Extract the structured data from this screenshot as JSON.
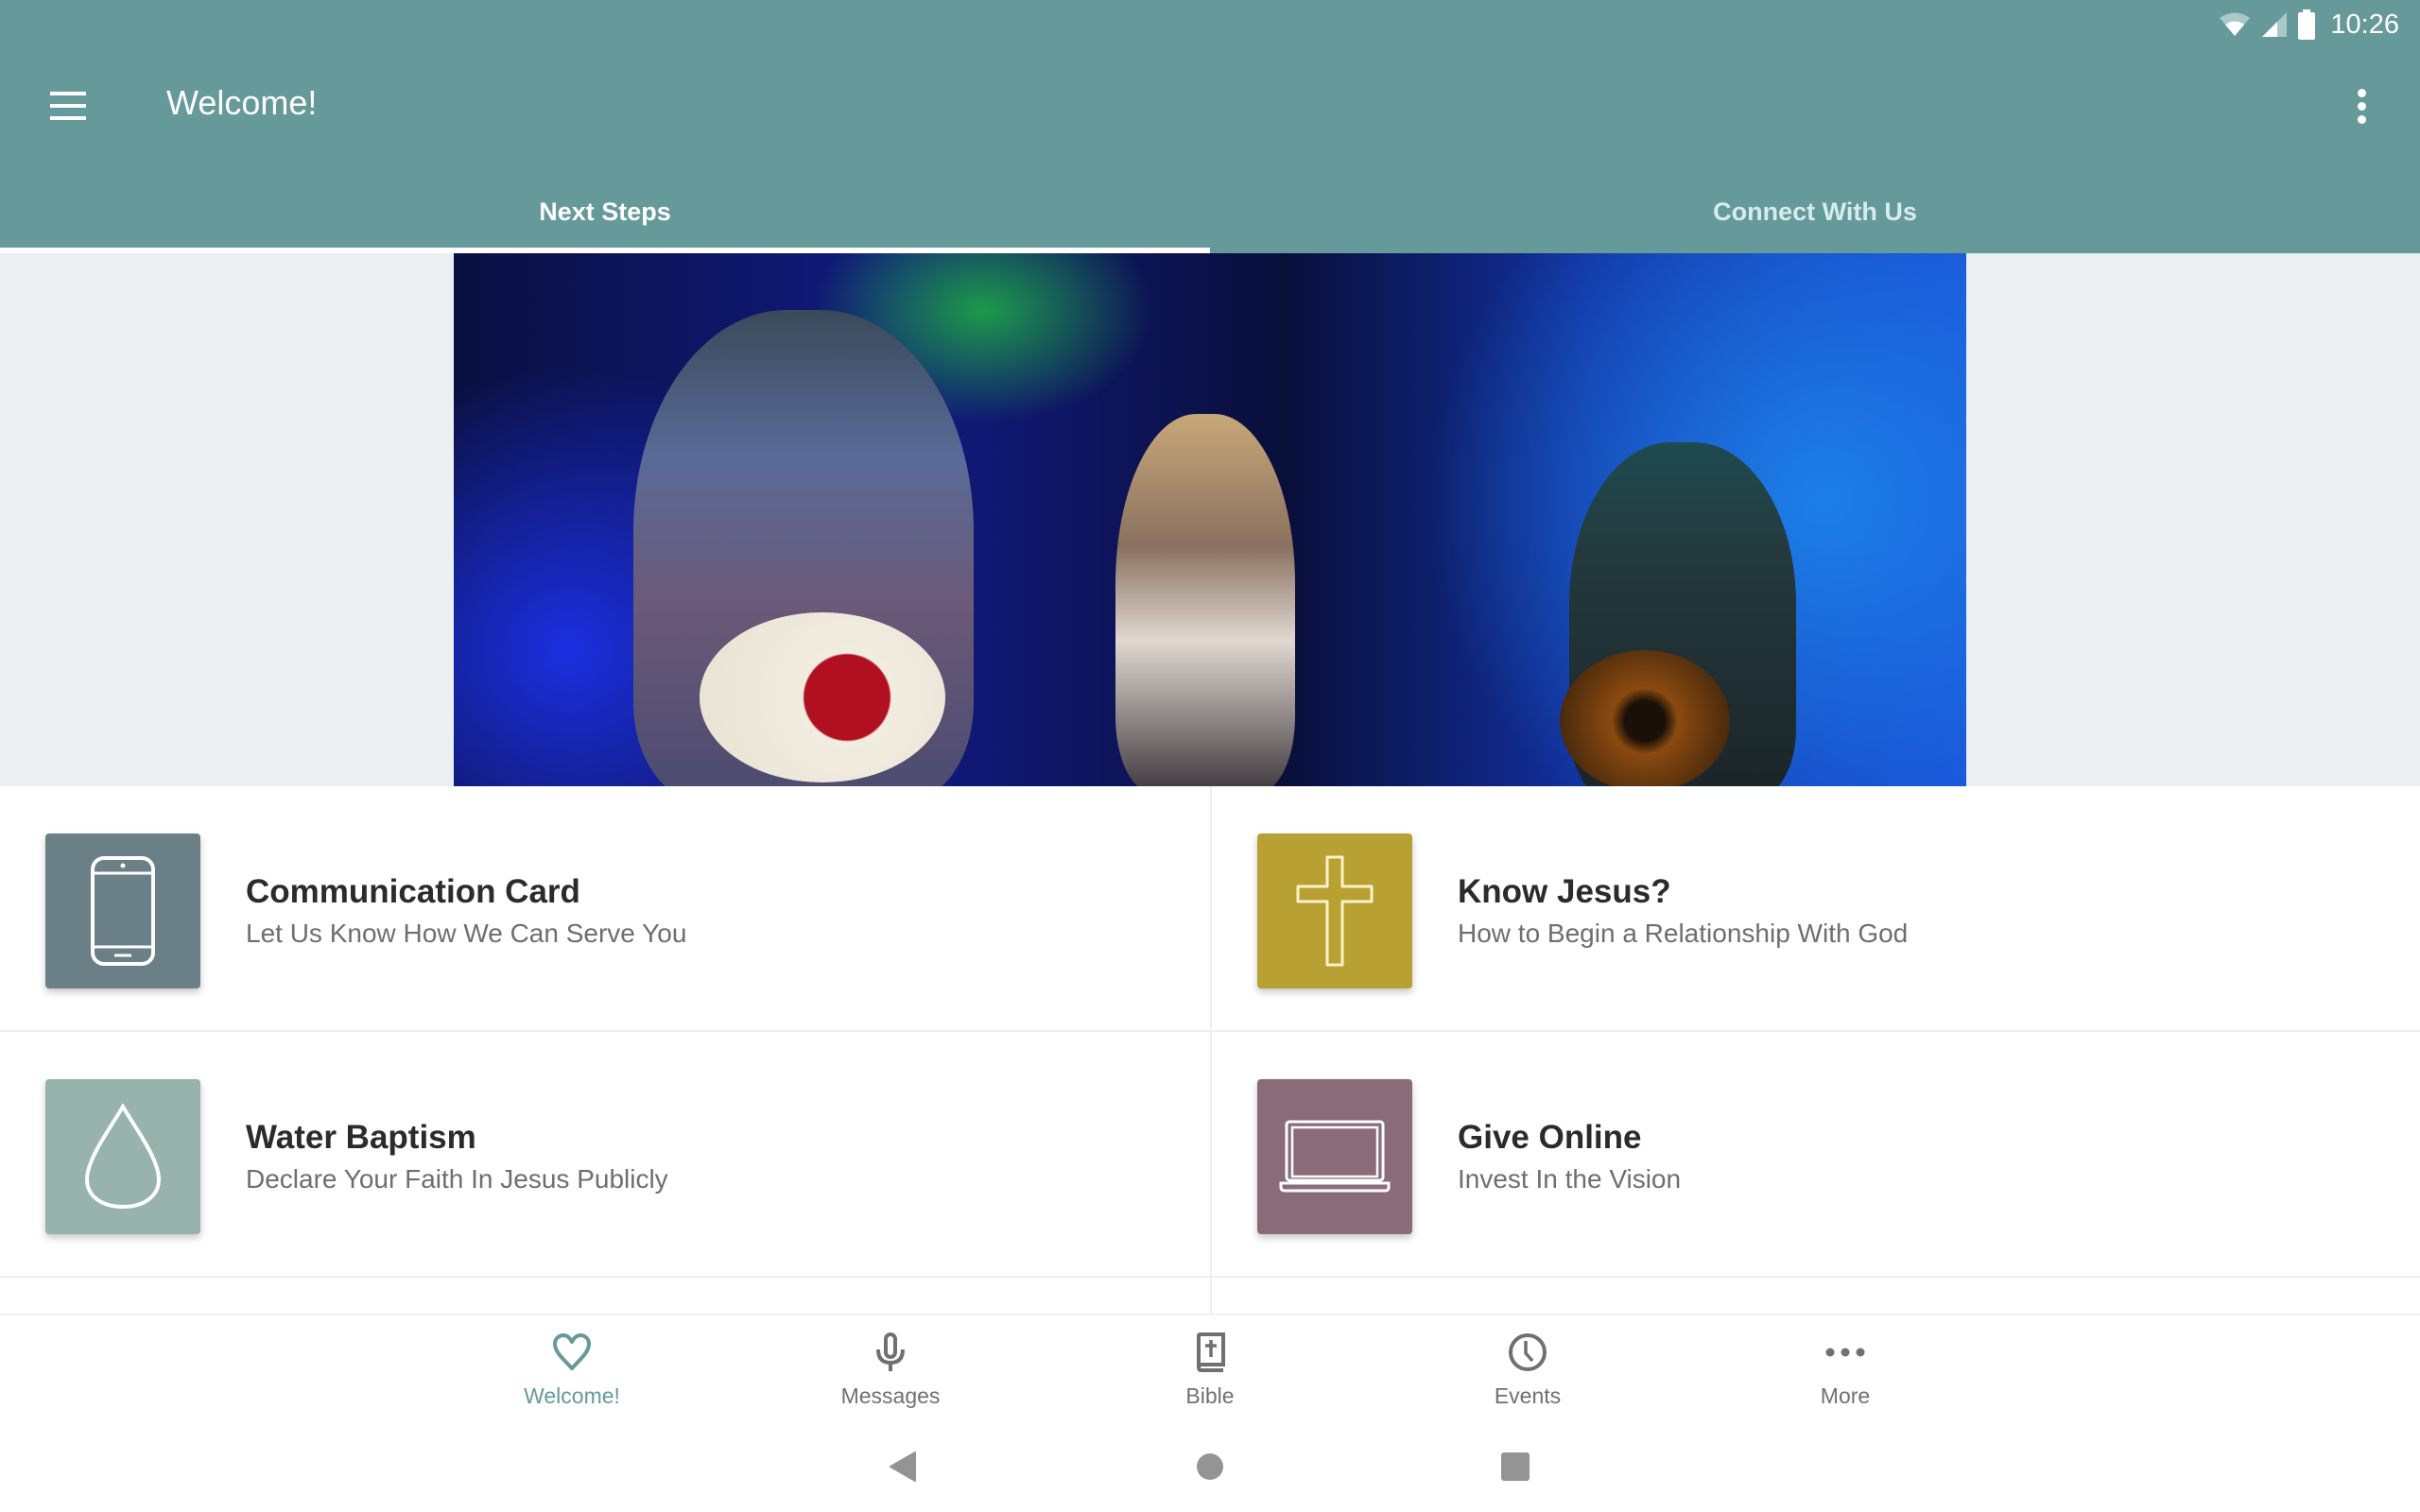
{
  "status_bar": {
    "time": "10:26",
    "icons": [
      "wifi-icon",
      "cell-signal-icon",
      "battery-icon"
    ]
  },
  "app_bar": {
    "title": "Welcome!",
    "menu_icon": "hamburger-menu-icon",
    "overflow_icon": "more-vertical-icon",
    "background_color": "#669999"
  },
  "tabs": [
    {
      "label": "Next Steps",
      "active": true
    },
    {
      "label": "Connect With Us",
      "active": false
    }
  ],
  "hero": {
    "alt": "Worship band performing on stage"
  },
  "cards": [
    {
      "title": "Communication Card",
      "subtitle": "Let Us Know How We Can Serve You",
      "icon": "smartphone-icon",
      "color": "#6b7f87"
    },
    {
      "title": "Know Jesus?",
      "subtitle": "How to Begin a Relationship With God",
      "icon": "cross-icon",
      "color": "#b9a033"
    },
    {
      "title": "Water Baptism",
      "subtitle": "Declare Your Faith In Jesus Publicly",
      "icon": "water-drop-icon",
      "color": "#97b3ac"
    },
    {
      "title": "Give Online",
      "subtitle": "Invest In the Vision",
      "icon": "laptop-icon",
      "color": "#8a6b78"
    }
  ],
  "bottom_nav": [
    {
      "label": "Welcome!",
      "icon": "heart-icon",
      "active": true
    },
    {
      "label": "Messages",
      "icon": "microphone-icon",
      "active": false
    },
    {
      "label": "Bible",
      "icon": "bible-icon",
      "active": false
    },
    {
      "label": "Events",
      "icon": "clock-icon",
      "active": false
    },
    {
      "label": "More",
      "icon": "more-horizontal-icon",
      "active": false
    }
  ],
  "system_nav": [
    "back-icon",
    "home-icon",
    "recents-icon"
  ],
  "colors": {
    "accent": "#669999",
    "nav_inactive": "#707070",
    "title_text": "#2b2b2b",
    "subtitle_text": "#6e6e6e"
  }
}
